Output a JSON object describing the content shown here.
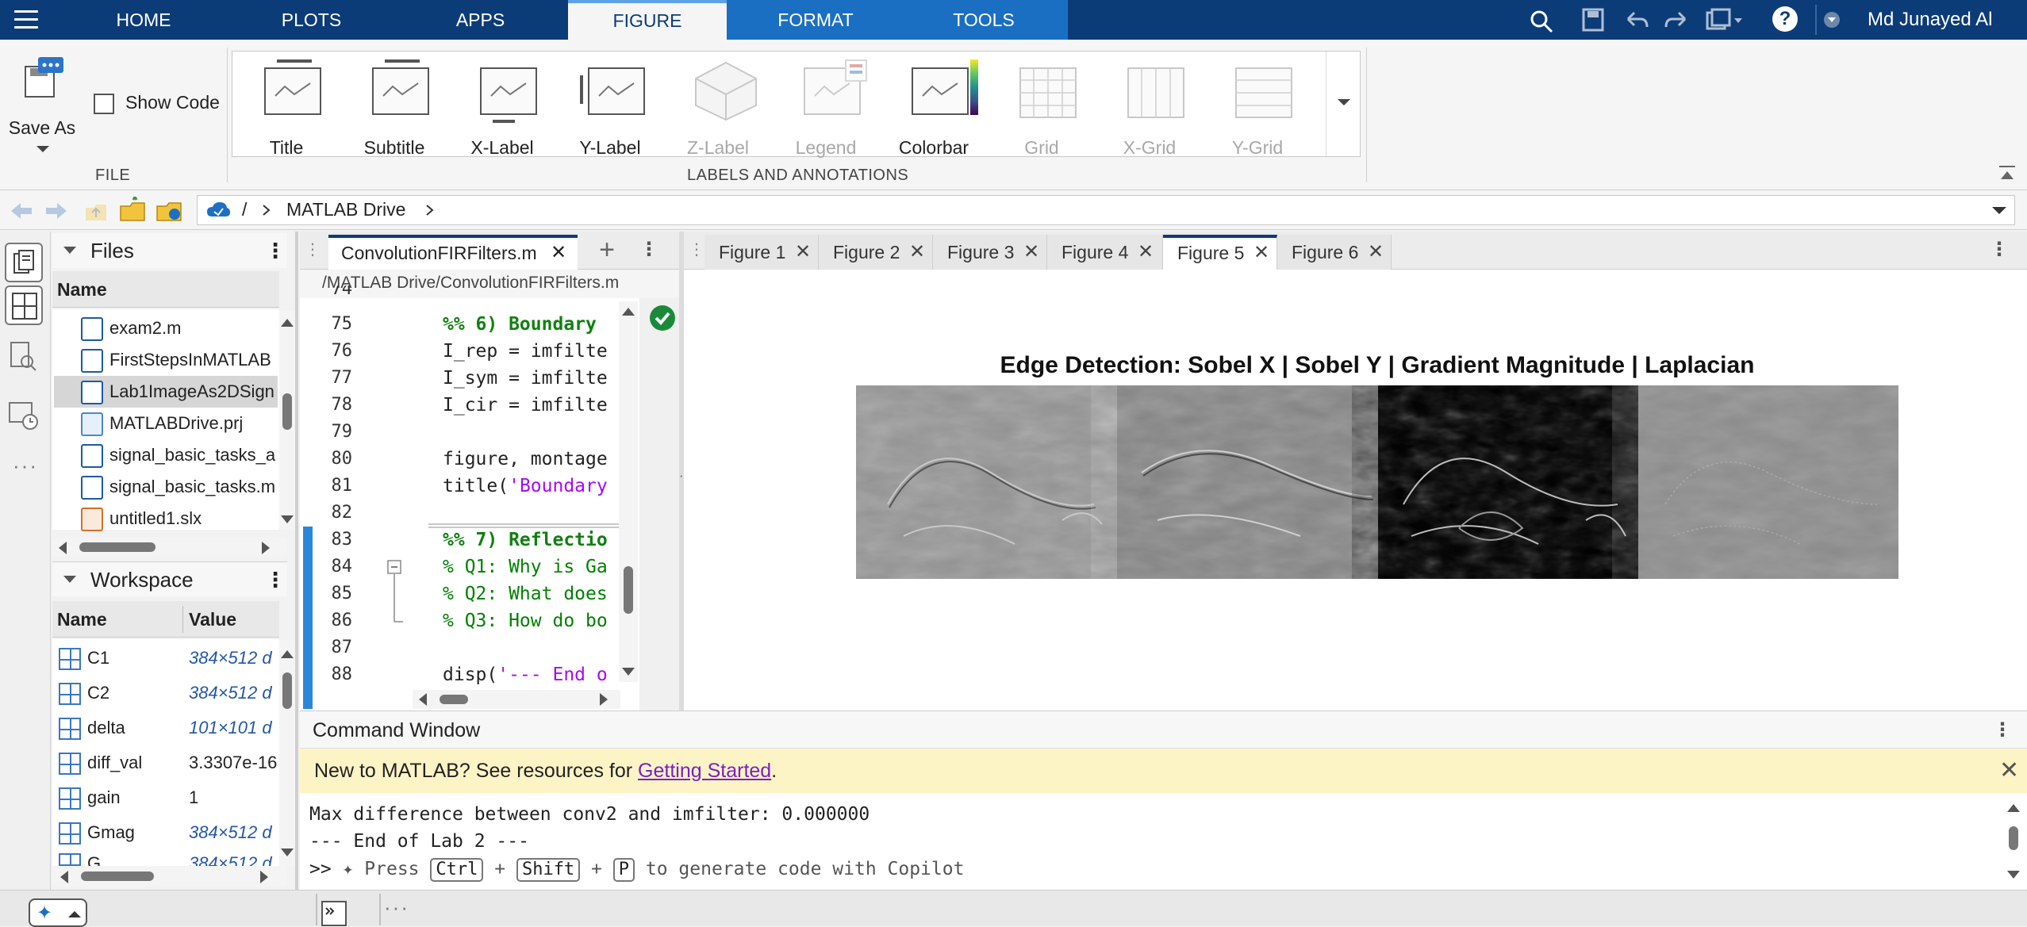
{
  "menu": {
    "tabs": [
      "HOME",
      "PLOTS",
      "APPS",
      "FIGURE",
      "FORMAT",
      "TOOLS"
    ],
    "active_tab": "FIGURE",
    "user_name": "Md Junayed Al"
  },
  "toolstrip": {
    "file_section": {
      "save_as_label": "Save As",
      "show_code_label": "Show Code",
      "section_label": "FILE"
    },
    "labels_section": {
      "section_label": "LABELS AND ANNOTATIONS",
      "items": [
        "Title",
        "Subtitle",
        "X-Label",
        "Y-Label",
        "Z-Label",
        "Legend",
        "Colorbar",
        "Grid",
        "X-Grid",
        "Y-Grid"
      ],
      "disabled": [
        "Z-Label",
        "Legend",
        "Grid",
        "X-Grid",
        "Y-Grid"
      ]
    }
  },
  "address": {
    "root": "/",
    "path_item": "MATLAB Drive"
  },
  "files_panel": {
    "title": "Files",
    "column_name": "Name",
    "items": [
      "exam2.m",
      "FirstStepsInMATLAB",
      "Lab1ImageAs2DSign",
      "MATLABDrive.prj",
      "signal_basic_tasks_a",
      "signal_basic_tasks.m",
      "untitled1.slx"
    ],
    "selected": "Lab1ImageAs2DSign"
  },
  "workspace_panel": {
    "title": "Workspace",
    "columns": [
      "Name",
      "Value"
    ],
    "rows": [
      {
        "name": "C1",
        "value": "384×512 d"
      },
      {
        "name": "C2",
        "value": "384×512 d"
      },
      {
        "name": "delta",
        "value": "101×101 d"
      },
      {
        "name": "diff_val",
        "value": "3.3307e-16"
      },
      {
        "name": "gain",
        "value": "1"
      },
      {
        "name": "Gmag",
        "value": "384×512 d"
      },
      {
        "name": "G...",
        "value": "384×512 d"
      }
    ]
  },
  "editor": {
    "tab_label": "ConvolutionFIRFilters.m",
    "file_path": "/MATLAB Drive/ConvolutionFIRFilters.m",
    "lines": [
      {
        "num": "75",
        "text": "%% 6) Boundary",
        "kind": "section"
      },
      {
        "num": "76",
        "text": "I_rep = imfilte",
        "kind": "code"
      },
      {
        "num": "77",
        "text": "I_sym = imfilte",
        "kind": "code"
      },
      {
        "num": "78",
        "text": "I_cir = imfilte",
        "kind": "code"
      },
      {
        "num": "79",
        "text": "",
        "kind": "code"
      },
      {
        "num": "80",
        "text": "figure, montage",
        "kind": "code"
      },
      {
        "num": "81",
        "text": "title('Boundary",
        "kind": "title"
      },
      {
        "num": "82",
        "text": "",
        "kind": "code"
      },
      {
        "num": "83",
        "text": "%% 7) Reflectio",
        "kind": "section"
      },
      {
        "num": "84",
        "text": "% Q1: Why is Ga",
        "kind": "comment"
      },
      {
        "num": "85",
        "text": "% Q2: What does",
        "kind": "comment"
      },
      {
        "num": "86",
        "text": "% Q3: How do bo",
        "kind": "comment"
      },
      {
        "num": "87",
        "text": "",
        "kind": "code"
      },
      {
        "num": "88",
        "text": "disp('--- End o",
        "kind": "disp"
      }
    ]
  },
  "figures": {
    "tabs": [
      "Figure 1",
      "Figure 2",
      "Figure 3",
      "Figure 4",
      "Figure 5",
      "Figure 6"
    ],
    "active": "Figure 5",
    "plot_title": "Edge Detection: Sobel X | Sobel Y | Gradient Magnitude | Laplacian"
  },
  "command_window": {
    "title": "Command Window",
    "banner_text": "New to MATLAB? See resources for ",
    "banner_link": "Getting Started",
    "banner_end": ".",
    "output_lines": [
      "Max difference between conv2 and imfilter: 0.000000",
      "--- End of Lab 2 ---"
    ],
    "prompt": ">>",
    "hint_before": "Press",
    "hint_key1": "Ctrl",
    "hint_plus": "+",
    "hint_key2": "Shift",
    "hint_key3": "P",
    "hint_after": "to generate code with Copilot"
  },
  "colors": {
    "menu_bar": "#0c3c78",
    "accent_blue": "#1a6fc2",
    "section_green": "#108010",
    "comment_green": "#028002",
    "string_purple": "#a709f5",
    "banner_yellow": "#fdf4c6"
  }
}
